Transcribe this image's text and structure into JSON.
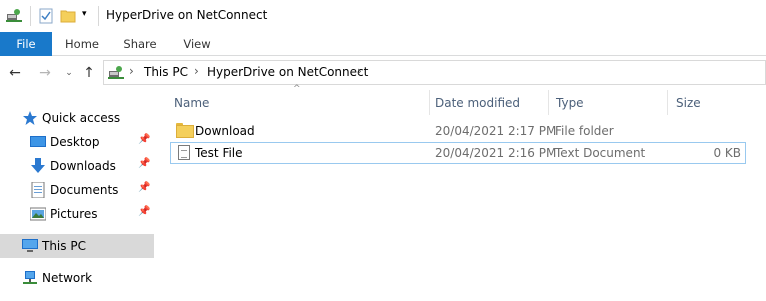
{
  "window": {
    "title": "HyperDrive on NetConnect"
  },
  "ribbon": {
    "tabs": [
      "File",
      "Home",
      "Share",
      "View"
    ]
  },
  "address": {
    "crumbs": [
      "This PC",
      "HyperDrive on NetConnect"
    ]
  },
  "sidebar": {
    "items": [
      {
        "label": "Quick access",
        "icon": "star-icon"
      },
      {
        "label": "Desktop",
        "icon": "desktop-icon"
      },
      {
        "label": "Downloads",
        "icon": "download-arrow-icon"
      },
      {
        "label": "Documents",
        "icon": "documents-icon"
      },
      {
        "label": "Pictures",
        "icon": "pictures-icon"
      },
      {
        "label": "This PC",
        "icon": "computer-icon"
      },
      {
        "label": "Network",
        "icon": "network-icon"
      }
    ]
  },
  "columns": {
    "name": "Name",
    "date": "Date modified",
    "type": "Type",
    "size": "Size"
  },
  "files": [
    {
      "name": "Download",
      "date": "20/04/2021 2:17 PM",
      "type": "File folder",
      "size": ""
    },
    {
      "name": "Test File",
      "date": "20/04/2021 2:16 PM",
      "type": "Text Document",
      "size": "0 KB"
    }
  ],
  "colors": {
    "accent": "#1979ca",
    "selection": "#d9d9d9",
    "row_selected_border": "#99c9ef",
    "header_text": "#4c607a"
  }
}
